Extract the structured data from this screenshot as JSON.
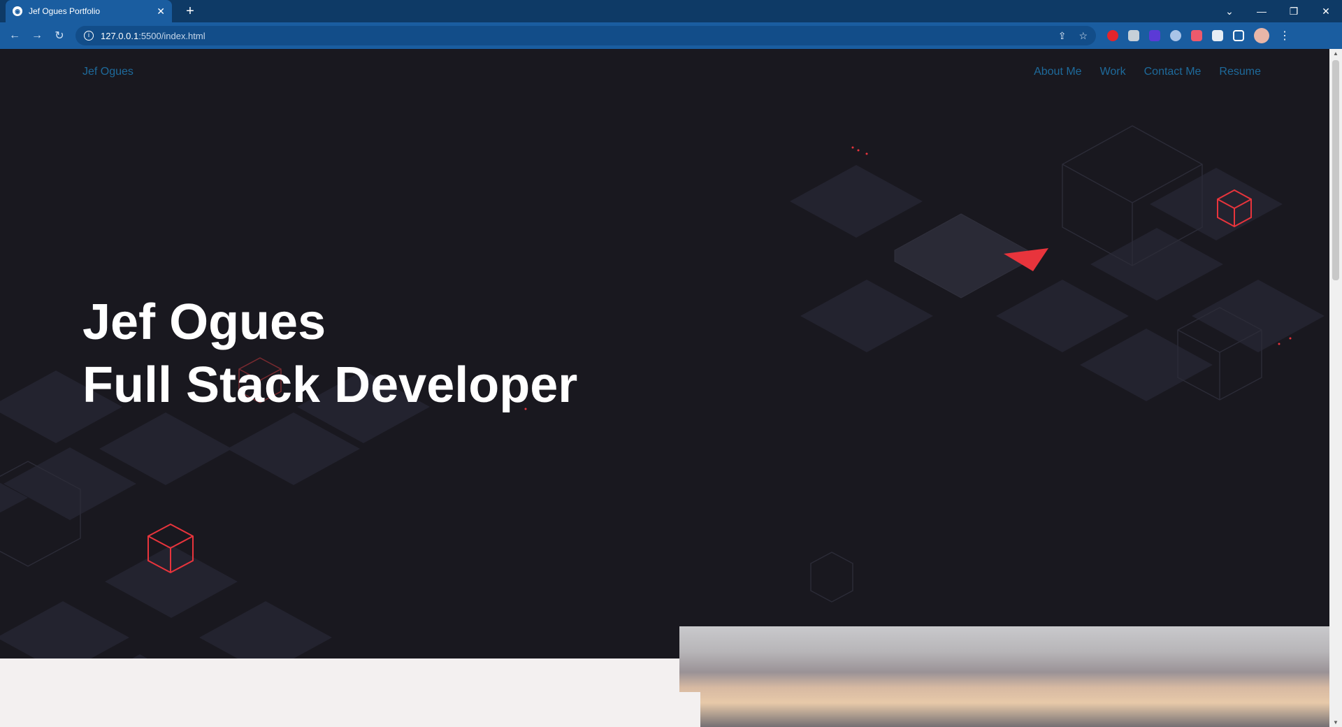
{
  "browser": {
    "tab_title": "Jef Ogues Portfolio",
    "url_host": "127.0.0.1",
    "url_rest": ":5500/index.html",
    "new_tab": "+",
    "close_tab": "✕"
  },
  "site": {
    "brand": "Jef Ogues",
    "nav": [
      "About Me",
      "Work",
      "Contact Me",
      "Resume"
    ],
    "headline_line1": "Jef Ogues",
    "headline_line2": "Full Stack Developer"
  },
  "colors": {
    "hero_bg": "#19181f",
    "tile": "#23232f",
    "accent_red": "#e8343c",
    "link_blue": "#1e6a9b"
  },
  "icons": {
    "deco": [
      "cube-outline-icon",
      "paper-plane-icon"
    ]
  }
}
